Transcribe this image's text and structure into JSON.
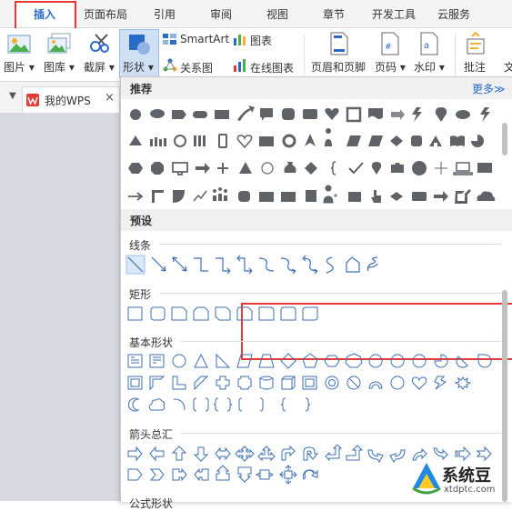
{
  "tabs": [
    {
      "label": "插入",
      "active": true
    },
    {
      "label": "页面布局"
    },
    {
      "label": "引用"
    },
    {
      "label": "审阅"
    },
    {
      "label": "视图"
    },
    {
      "label": "章节"
    },
    {
      "label": "开发工具"
    },
    {
      "label": "云服务"
    }
  ],
  "ribbon": {
    "picture": "图片",
    "gallery": "图库",
    "screenshot": "截屏",
    "shapes": "形状",
    "smartart": "SmartArt",
    "chart": "图表",
    "relation": "关系图",
    "online_chart": "在线图表",
    "header_footer": "页眉和页脚",
    "page_number": "页码",
    "watermark": "水印",
    "comment": "批注",
    "text_cut": "文"
  },
  "doc_tabs": {
    "wps_tab": "我的WPS",
    "close": "×"
  },
  "panel": {
    "recommend_title": "推荐",
    "more_link": "更多≫",
    "preset_title": "预设",
    "sections": [
      {
        "title": "线条"
      },
      {
        "title": "矩形"
      },
      {
        "title": "基本形状"
      },
      {
        "title": "箭头总汇"
      },
      {
        "title": "公式形状"
      }
    ]
  },
  "watermark": {
    "brand": "系统豆",
    "url": "xtdptc.com"
  },
  "colors": {
    "accent_blue": "#2b6bc8",
    "highlight_red": "#e53935",
    "shape_fill": "#5f6368",
    "preset_stroke": "#3d6fb3"
  }
}
